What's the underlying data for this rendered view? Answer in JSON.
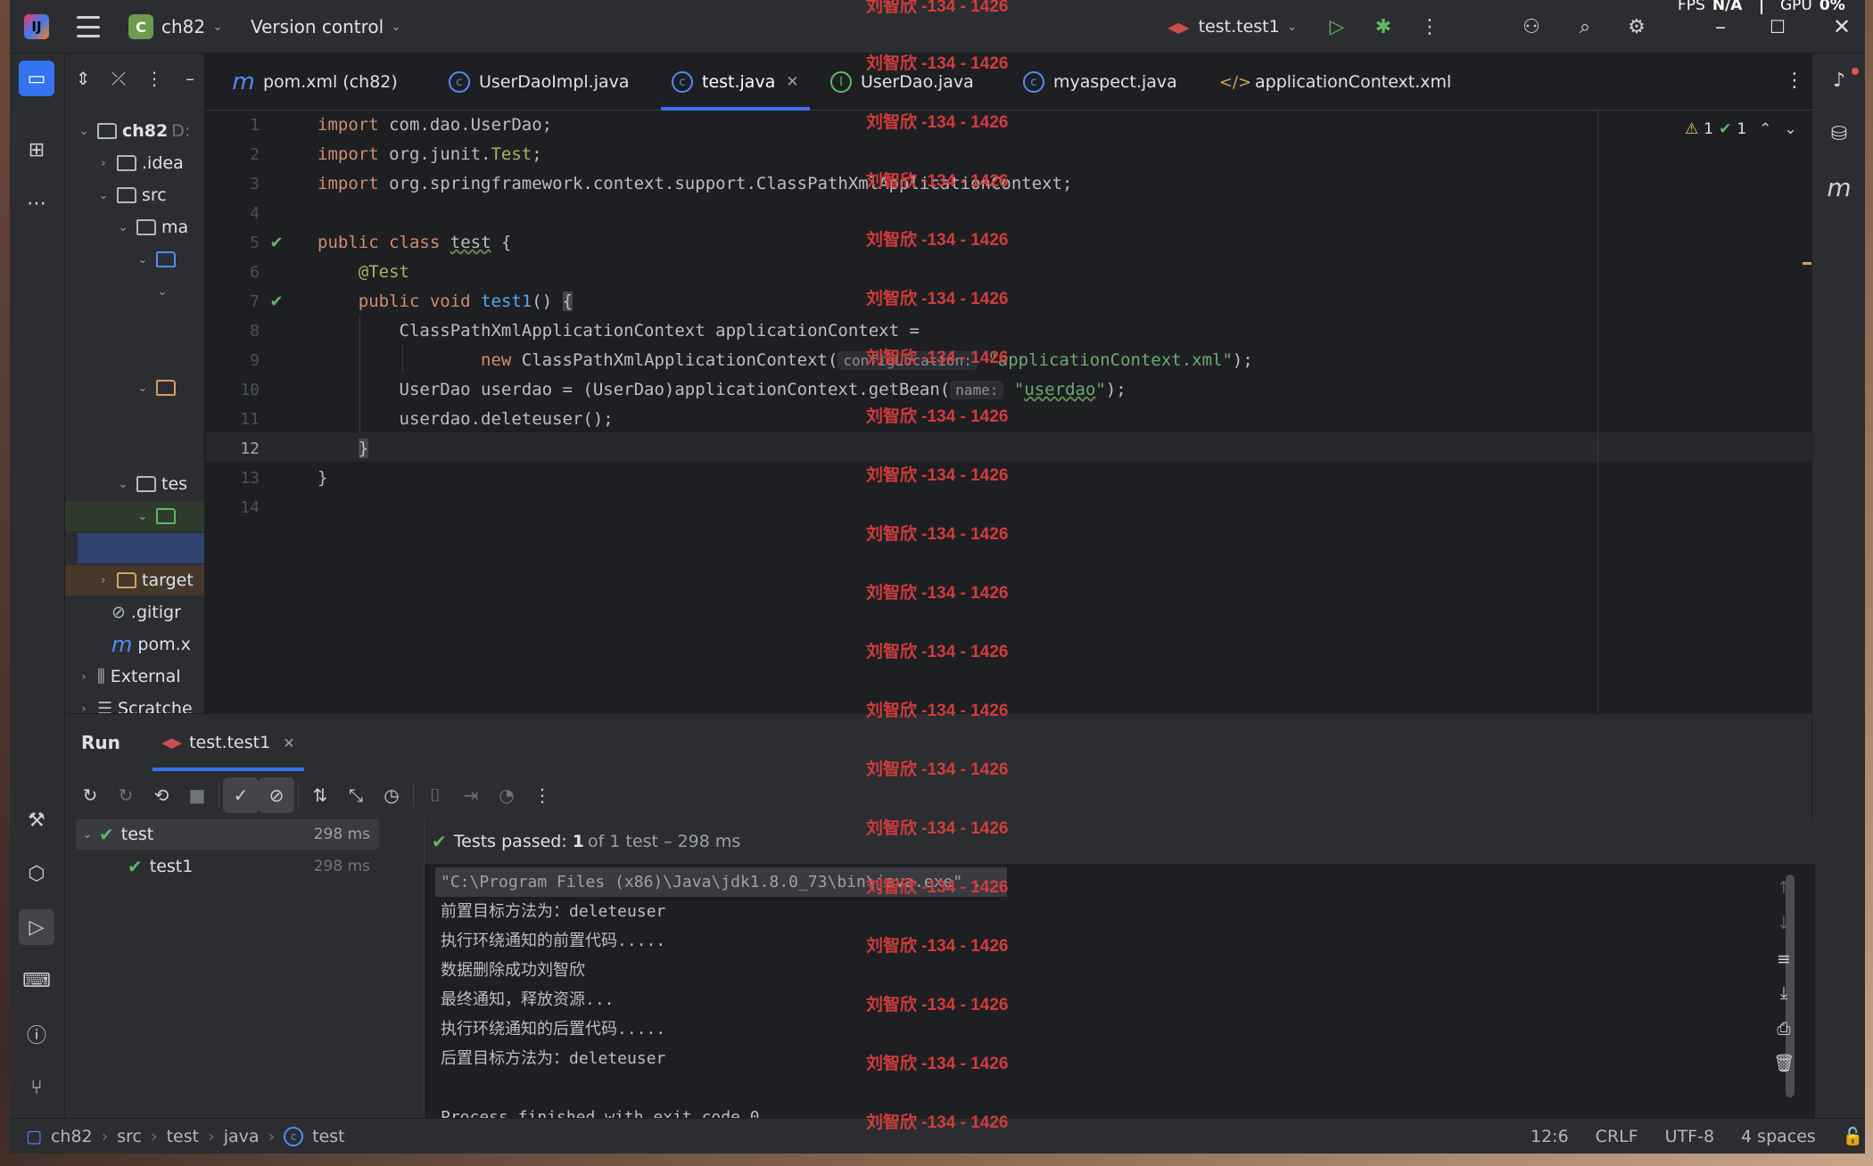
{
  "titlebar": {
    "project_letter": "C",
    "project_name": "ch82",
    "vcs_label": "Version control",
    "run_config": "test.test1",
    "fps_label": "FPS",
    "fps_value": "N/A",
    "gpu_label": "GPU",
    "gpu_value": "0%"
  },
  "project_tree": {
    "items": [
      {
        "label": "ch82",
        "extra": "D:"
      },
      {
        "label": ".idea"
      },
      {
        "label": "src"
      },
      {
        "label": "ma"
      },
      {
        "label": ""
      },
      {
        "label": ""
      },
      {
        "label": ""
      },
      {
        "label": "tes"
      },
      {
        "label": ""
      },
      {
        "label": ""
      },
      {
        "label": "target"
      },
      {
        "label": ".gitigr"
      },
      {
        "label": "pom.x"
      },
      {
        "label": "External"
      },
      {
        "label": "Scratche"
      }
    ]
  },
  "tabs": [
    {
      "label": "pom.xml (ch82)",
      "icon": "maven-icon"
    },
    {
      "label": "UserDaoImpl.java",
      "icon": "class-icon"
    },
    {
      "label": "test.java",
      "icon": "class-icon",
      "active": true
    },
    {
      "label": "UserDao.java",
      "icon": "interface-icon"
    },
    {
      "label": "myaspect.java",
      "icon": "class-icon"
    },
    {
      "label": "applicationContext.xml",
      "icon": "xml-icon"
    }
  ],
  "editor": {
    "line_numbers": [
      "1",
      "2",
      "3",
      "4",
      "5",
      "6",
      "7",
      "8",
      "9",
      "10",
      "11",
      "12",
      "13",
      "14"
    ],
    "current_line": "12",
    "inspection_warnings": "1",
    "inspection_ok": "1",
    "code": {
      "l1_kw": "import",
      "l1_rest": " com.dao.UserDao;",
      "l2_kw": "import",
      "l2_rest": " org.junit.",
      "l2_cls": "Test",
      "l2_end": ";",
      "l3_kw": "import",
      "l3_rest": " org.springframework.context.support.ClassPathXmlApplicationContext;",
      "l5_kw1": "public",
      "l5_kw2": "class",
      "l5_name": "test",
      "l5_end": " {",
      "l6_ann": "@Test",
      "l7_kw1": "public",
      "l7_kw2": "void",
      "l7_fn": "test1",
      "l7_paren": "()",
      "l7_brace": "{",
      "l8": "ClassPathXmlApplicationContext applicationContext =",
      "l9_kw": "new",
      "l9_cls": " ClassPathXmlApplicationContext(",
      "l9_hint": "configLocation:",
      "l9_str": "\"applicationContext.xml\"",
      "l9_end": ");",
      "l10_pre": "UserDao userdao = (UserDao)applicationContext.getBean(",
      "l10_hint": "name:",
      "l10_str_q1": "\"",
      "l10_str": "userdao",
      "l10_str_q2": "\"",
      "l10_end": ");",
      "l11": "userdao.deleteuser();",
      "l12": "}",
      "l13": "}"
    }
  },
  "run_panel": {
    "title": "Run",
    "tab_label": "test.test1",
    "tree": [
      {
        "label": "test",
        "time": "298 ms"
      },
      {
        "label": "test1",
        "time": "298 ms"
      }
    ],
    "status_prefix": "Tests passed:",
    "status_count": "1",
    "status_rest": "of 1 test – 298 ms",
    "output": [
      "\"C:\\Program Files (x86)\\Java\\jdk1.8.0_73\\bin\\java.exe\" ...",
      "前置目标方法为：deleteuser",
      "执行环绕通知的前置代码.....",
      "数据删除成功刘智欣",
      "最终通知，释放资源...",
      "执行环绕通知的后置代码.....",
      "后置目标方法为：deleteuser",
      "",
      "Process finished with exit code 0"
    ]
  },
  "statusbar": {
    "crumbs": [
      "ch82",
      "src",
      "test",
      "java",
      "test"
    ],
    "position": "12:6",
    "line_sep": "CRLF",
    "encoding": "UTF-8",
    "indent": "4 spaces"
  },
  "watermark": "刘智欣 -134 - 1426"
}
